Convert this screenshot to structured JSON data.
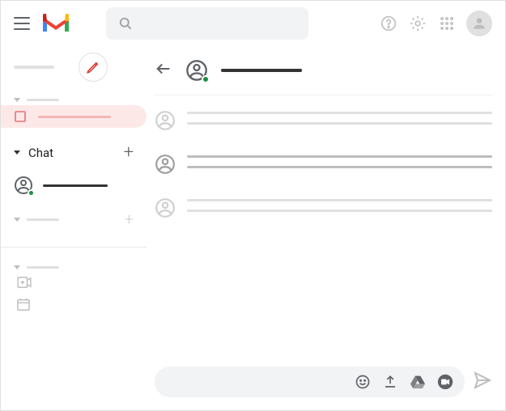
{
  "header": {
    "logo_colors": {
      "red": "#EA4335",
      "blue": "#4285F4",
      "green": "#34A853",
      "yellow": "#FBBC04"
    }
  },
  "sidebar": {
    "chat_label": "Chat"
  },
  "compose": {
    "placeholder": ""
  }
}
